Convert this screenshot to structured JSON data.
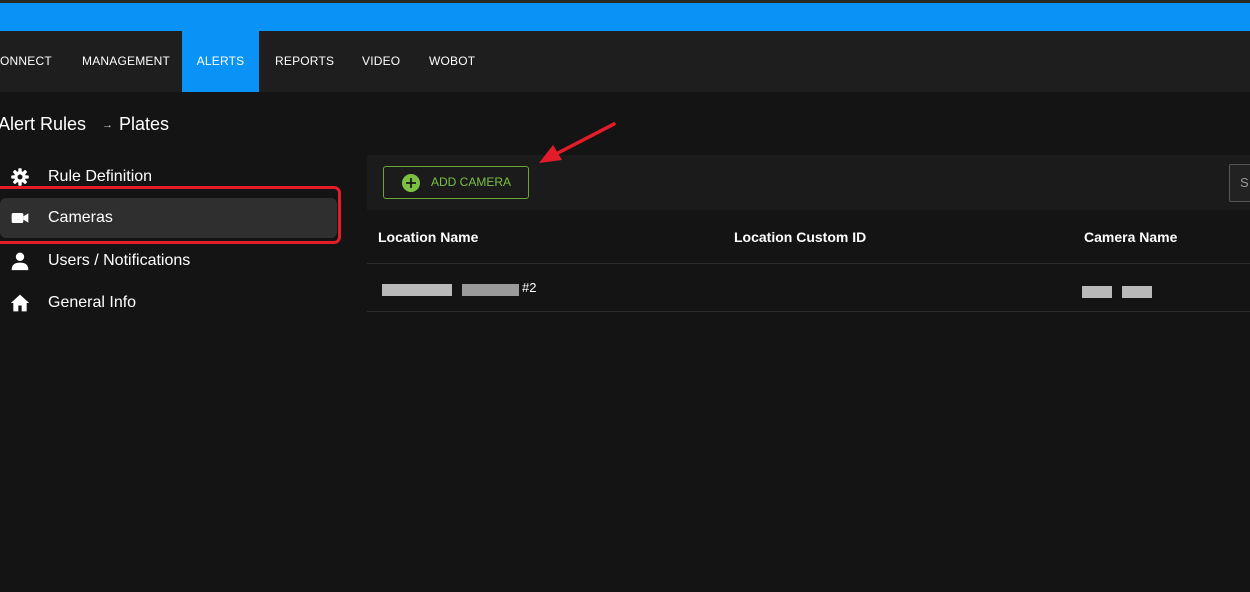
{
  "nav": {
    "items": [
      {
        "label": "ONNECT",
        "active": false
      },
      {
        "label": "MANAGEMENT",
        "active": false
      },
      {
        "label": "ALERTS",
        "active": true
      },
      {
        "label": "REPORTS",
        "active": false
      },
      {
        "label": "VIDEO",
        "active": false
      },
      {
        "label": "WOBOT",
        "active": false
      }
    ]
  },
  "breadcrumb": {
    "parent": "Alert Rules",
    "separator": "→",
    "current": "Plates"
  },
  "sidebar": {
    "items": [
      {
        "label": "Rule Definition",
        "icon": "gear-icon",
        "active": false
      },
      {
        "label": "Cameras",
        "icon": "video-camera-icon",
        "active": true
      },
      {
        "label": "Users / Notifications",
        "icon": "user-icon",
        "active": false
      },
      {
        "label": "General Info",
        "icon": "home-icon",
        "active": false
      }
    ]
  },
  "toolbar": {
    "add_camera_label": "ADD CAMERA",
    "search_placeholder": "S"
  },
  "table": {
    "columns": [
      "Location Name",
      "Location Custom ID",
      "Camera Name"
    ],
    "rows": [
      {
        "location_name_visible": "#2",
        "location_custom_id": "",
        "camera_name": ""
      }
    ]
  },
  "colors": {
    "accent_blue": "#0a93f6",
    "add_green": "#7cc043",
    "annotation_red": "#e31c2a"
  }
}
